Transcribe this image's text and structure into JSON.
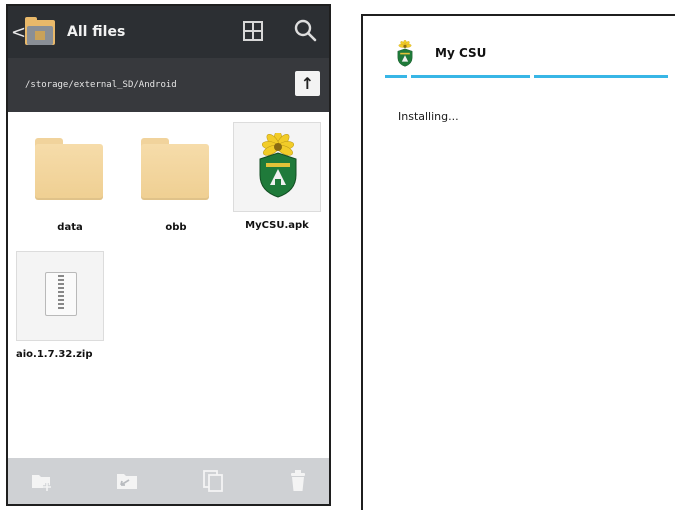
{
  "file_manager": {
    "header": {
      "title": "All files",
      "back_glyph": "<",
      "app_icon": "folder-app-icon",
      "grid_view_icon": "grid-view-icon",
      "search_icon": "search-icon"
    },
    "path_bar": {
      "path": "/storage/external_SD/Android",
      "up_glyph": "↑",
      "up_icon": "up-arrow-icon"
    },
    "items": [
      {
        "label": "data",
        "type": "folder"
      },
      {
        "label": "obb",
        "type": "folder"
      },
      {
        "label": "MyCSU.apk",
        "type": "apk"
      },
      {
        "label": "aio.1.7.32.zip",
        "type": "zip"
      }
    ],
    "toolbar": {
      "tools": [
        "new-folder-icon",
        "move-icon",
        "copy-icon",
        "delete-icon"
      ],
      "icon_color": "#f4f4f4"
    },
    "colors": {
      "header_bg": "#2c2f33",
      "path_bg": "#37393d",
      "folder": "#f6dcaa",
      "toolbar_bg": "#cfd1d4"
    }
  },
  "installer": {
    "title": "My CSU",
    "status": "Installing...",
    "accent": "#38b6e6",
    "app_icon": "mycsu-shield-icon"
  }
}
